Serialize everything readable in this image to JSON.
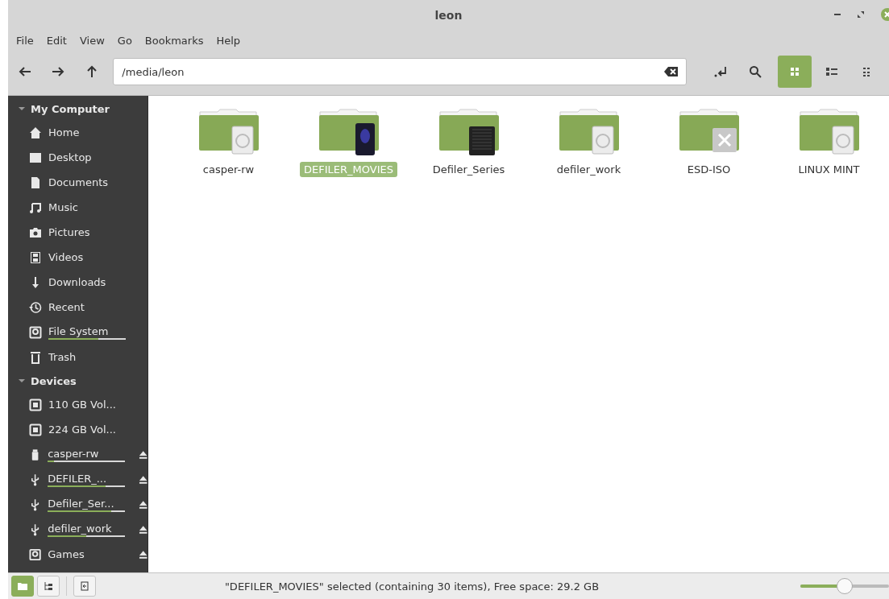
{
  "window": {
    "title": "leon"
  },
  "menu": [
    "File",
    "Edit",
    "View",
    "Go",
    "Bookmarks",
    "Help"
  ],
  "location": {
    "value": "/media/leon"
  },
  "view_buttons": [
    {
      "kind": "icons",
      "selected": true
    },
    {
      "kind": "list",
      "selected": false
    },
    {
      "kind": "compact",
      "selected": false
    }
  ],
  "sidebar": {
    "sections": [
      {
        "title": "My Computer",
        "expanded": true,
        "items": [
          {
            "label": "Home",
            "kind": "home"
          },
          {
            "label": "Desktop",
            "kind": "desktop"
          },
          {
            "label": "Documents",
            "kind": "document"
          },
          {
            "label": "Music",
            "kind": "music"
          },
          {
            "label": "Pictures",
            "kind": "camera"
          },
          {
            "label": "Videos",
            "kind": "film"
          },
          {
            "label": "Downloads",
            "kind": "download"
          },
          {
            "label": "Recent",
            "kind": "recent"
          },
          {
            "label": "File System",
            "kind": "disk",
            "level": 0.65
          },
          {
            "label": "Trash",
            "kind": "trash"
          }
        ]
      },
      {
        "title": "Devices",
        "expanded": true,
        "items": [
          {
            "label": "110 GB Vol...",
            "kind": "chip"
          },
          {
            "label": "224 GB Vol...",
            "kind": "chip"
          },
          {
            "label": "casper-rw",
            "kind": "stick",
            "level": 0.08,
            "eject": true
          },
          {
            "label": "DEFILER_...",
            "kind": "usb",
            "level": 0.75,
            "eject": true
          },
          {
            "label": "Defiler_Ser...",
            "kind": "usb",
            "level": 0.82,
            "eject": true
          },
          {
            "label": "defiler_work",
            "kind": "usb",
            "level": 0.5,
            "eject": true
          },
          {
            "label": "Games",
            "kind": "disk",
            "eject": true
          }
        ]
      }
    ]
  },
  "files": [
    {
      "name": "casper-rw",
      "kind": "drive",
      "selected": false
    },
    {
      "name": "DEFILER_MOVIES",
      "kind": "media",
      "selected": true
    },
    {
      "name": "Defiler_Series",
      "kind": "external",
      "selected": false
    },
    {
      "name": "defiler_work",
      "kind": "drive",
      "selected": false
    },
    {
      "name": "ESD-ISO",
      "kind": "error",
      "selected": false
    },
    {
      "name": "LINUX MINT",
      "kind": "drive",
      "selected": false
    }
  ],
  "status_bar": {
    "pane_buttons": [
      {
        "kind": "places",
        "selected": true
      },
      {
        "kind": "tree",
        "selected": false
      }
    ],
    "text": "\"DEFILER_MOVIES\" selected (containing 30 items), Free space: 29.2 GB",
    "zoom": {
      "level": 0.5
    }
  }
}
